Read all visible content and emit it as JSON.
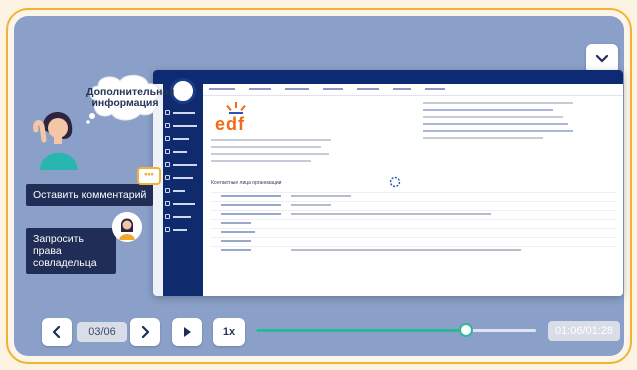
{
  "overlay": {
    "info_bubble": "Дополнительная информация",
    "comment_label": "Оставить комментарий",
    "comment_icon_glyph": "•••",
    "request_label": "Запросить права совладельца"
  },
  "app": {
    "logo_text": "edf",
    "section_title": "Контактные лица организации"
  },
  "player": {
    "slide_counter": "03/06",
    "speed_label": "1x",
    "time_label": "01:06/01:28",
    "progress": 0.75,
    "accent": "#2fb69a"
  },
  "icons": [
    "chevron-down-icon",
    "chevron-left-icon",
    "chevron-right-icon",
    "play-icon",
    "comment-icon"
  ]
}
